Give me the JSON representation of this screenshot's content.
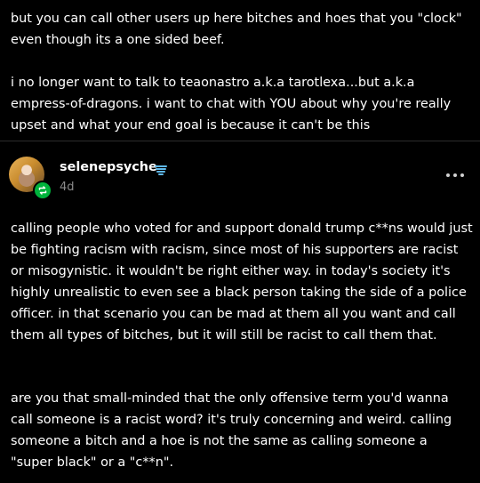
{
  "previous_post": {
    "paragraph_1": "but you can call other users up here bitches and hoes that you \"clock\" even though its a one sided beef.",
    "paragraph_2": "i no longer want to talk to teaonastro a.k.a tarotlexa...but a.k.a empress-of-dragons.  i want to chat with YOU about why you're really upset and what your end goal is because it can't be this"
  },
  "reblog": {
    "username": "selenepsyche",
    "timestamp": "4d",
    "paragraph_1": "calling people who voted for and support donald trump c**ns would just be fighting racism with racism, since most of his supporters are racist or misogynistic. it wouldn't be right either way. in today's society it's highly unrealistic to even see a black person taking the side of a police officer. in that scenario you can be mad at them all you want and call them all types of bitches, but it will still be racist to call them that.",
    "paragraph_2": "are you that small-minded that the only offensive term you'd wanna call someone is a racist word? it's truly concerning and weird. calling someone a bitch and a hoe is not the same as calling someone a \"super black\" or a \"c**n\"."
  },
  "icons": {
    "avatar": "avatar",
    "badge": "reblog-icon",
    "verified": "verified-badge-icon",
    "menu": "more-options-icon"
  },
  "colors": {
    "background": "#000000",
    "text": "#ffffff",
    "muted": "#8c8c8c",
    "badge": "#00b33c",
    "verified": "#5fb8e8",
    "divider": "#2c2c2c"
  }
}
